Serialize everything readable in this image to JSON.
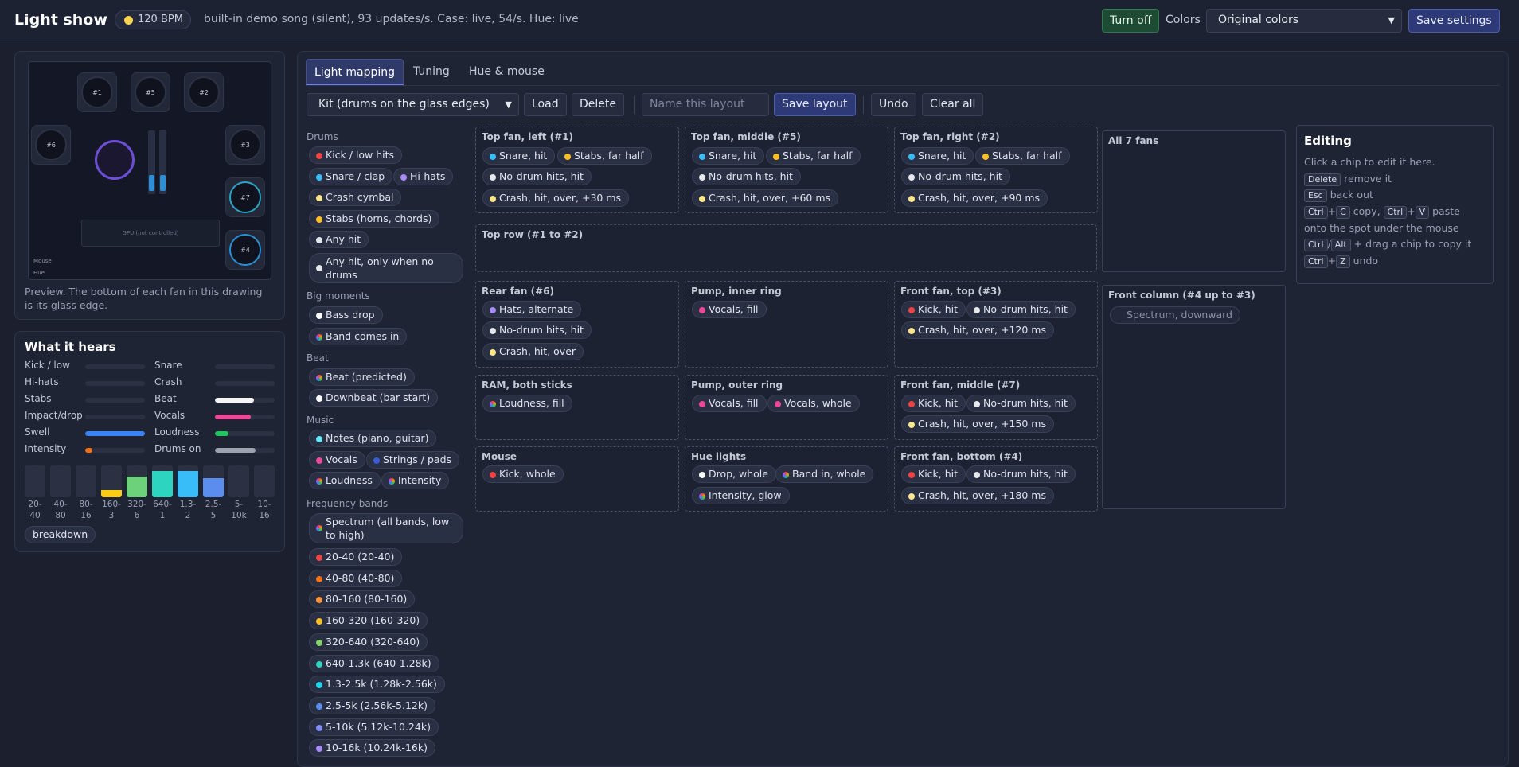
{
  "header": {
    "title": "Light show",
    "bpm": "120 BPM",
    "status": "built-in demo song (silent), 93 updates/s. Case: live, 54/s. Hue: live",
    "turn_off": "Turn off",
    "colors_label": "Colors",
    "colors_value": "Original colors",
    "save_settings": "Save settings"
  },
  "preview": {
    "fan_labels": [
      "#1",
      "#5",
      "#2",
      "#6",
      "#3",
      "#7",
      "#4"
    ],
    "gpu_label": "GPU (not controlled)",
    "mouse_label": "Mouse",
    "hue_label": "Hue",
    "caption": "Preview. The bottom of each fan in this drawing is its glass edge."
  },
  "hears": {
    "title": "What it hears",
    "meters": [
      {
        "name": "Kick / low",
        "level": 0,
        "color": "#3b82f6"
      },
      {
        "name": "Snare",
        "level": 0,
        "color": "#3b82f6"
      },
      {
        "name": "Hi-hats",
        "level": 0,
        "color": "#3b82f6"
      },
      {
        "name": "Crash",
        "level": 0,
        "color": "#3b82f6"
      },
      {
        "name": "Stabs",
        "level": 0,
        "color": "#3b82f6"
      },
      {
        "name": "Beat",
        "level": 0.65,
        "color": "#f5f5f5"
      },
      {
        "name": "Impact/drop",
        "level": 0,
        "color": "#3b82f6"
      },
      {
        "name": "Vocals",
        "level": 0.6,
        "color": "#ec4899"
      },
      {
        "name": "Swell",
        "level": 1.0,
        "color": "#3b82f6"
      },
      {
        "name": "Loudness",
        "level": 0.22,
        "color": "#22c55e"
      },
      {
        "name": "Intensity",
        "level": 0.12,
        "color": "#f97316"
      },
      {
        "name": "Drums on",
        "level": 0.68,
        "color": "#9ca3af"
      }
    ],
    "bands": [
      {
        "label": "20-\n40",
        "level": 0,
        "color": "#facc15"
      },
      {
        "label": "40-\n80",
        "level": 0,
        "color": "#facc15"
      },
      {
        "label": "80-\n16",
        "level": 0,
        "color": "#facc15"
      },
      {
        "label": "160-\n3",
        "level": 0.22,
        "color": "#facc15"
      },
      {
        "label": "320-\n6",
        "level": 0.65,
        "color": "#6dd07a"
      },
      {
        "label": "640-\n1",
        "level": 0.82,
        "color": "#2dd4bf"
      },
      {
        "label": "1.3-\n2",
        "level": 0.82,
        "color": "#38bdf8"
      },
      {
        "label": "2.5-\n5",
        "level": 0.6,
        "color": "#5b8def"
      },
      {
        "label": "5-\n10k",
        "level": 0,
        "color": "#facc15"
      },
      {
        "label": "10-\n16",
        "level": 0,
        "color": "#facc15"
      }
    ],
    "breakdown": "breakdown"
  },
  "tabs": [
    "Light mapping",
    "Tuning",
    "Hue & mouse"
  ],
  "toolbar": {
    "layout_select": "Kit (drums on the glass edges)",
    "load": "Load",
    "delete": "Delete",
    "name_placeholder": "Name this layout",
    "save_layout": "Save layout",
    "undo": "Undo",
    "clear_all": "Clear all"
  },
  "palette": {
    "sections": [
      "Drums",
      "Big moments",
      "Beat",
      "Music",
      "Frequency bands"
    ],
    "drums": [
      {
        "label": "Kick / low hits",
        "color": "#ef4444"
      },
      {
        "label": "Snare / clap",
        "color": "#38bdf8"
      },
      {
        "label": "Hi-hats",
        "color": "#a78bfa"
      },
      {
        "label": "Crash cymbal",
        "color": "#fde68a"
      },
      {
        "label": "Stabs (horns, chords)",
        "color": "#fbbf24"
      },
      {
        "label": "Any hit",
        "color": "#e5e7eb"
      },
      {
        "label": "Any hit, only when no drums",
        "color": "#e5e7eb"
      }
    ],
    "big": [
      {
        "label": "Bass drop",
        "color": "#ffffff"
      },
      {
        "label": "Band comes in",
        "color": "rainbow"
      }
    ],
    "beat": [
      {
        "label": "Beat (predicted)",
        "color": "rainbow"
      },
      {
        "label": "Downbeat (bar start)",
        "color": "#ffffff"
      }
    ],
    "music": [
      {
        "label": "Notes (piano, guitar)",
        "color": "#67e8f9"
      },
      {
        "label": "Vocals",
        "color": "#ec4899"
      },
      {
        "label": "Strings / pads",
        "color": "#3b5bdb"
      },
      {
        "label": "Loudness",
        "color": "rainbow"
      },
      {
        "label": "Intensity",
        "color": "rainbow"
      }
    ],
    "bands": [
      {
        "label": "Spectrum (all bands, low to high)",
        "color": "rainbow"
      },
      {
        "label": "20-40 (20-40)",
        "color": "#ef4444"
      },
      {
        "label": "40-80 (40-80)",
        "color": "#f97316"
      },
      {
        "label": "80-160 (80-160)",
        "color": "#fb923c"
      },
      {
        "label": "160-320 (160-320)",
        "color": "#fbbf24"
      },
      {
        "label": "320-640 (320-640)",
        "color": "#86d46a"
      },
      {
        "label": "640-1.3k (640-1.28k)",
        "color": "#2dd4bf"
      },
      {
        "label": "1.3-2.5k (1.28k-2.56k)",
        "color": "#22d3ee"
      },
      {
        "label": "2.5-5k (2.56k-5.12k)",
        "color": "#5b8def"
      },
      {
        "label": "5-10k (5.12k-10.24k)",
        "color": "#818cf8"
      },
      {
        "label": "10-16k (10.24k-16k)",
        "color": "#a78bfa"
      }
    ]
  },
  "zones": {
    "top_left": {
      "title": "Top fan, left (#1)",
      "chips": [
        {
          "label": "Snare, hit",
          "color": "#38bdf8"
        },
        {
          "label": "Stabs, far half",
          "color": "#fbbf24"
        },
        {
          "label": "No-drum hits, hit",
          "color": "#e5e7eb"
        },
        {
          "label": "Crash, hit, over, +30 ms",
          "color": "#fde68a"
        }
      ]
    },
    "top_mid": {
      "title": "Top fan, middle (#5)",
      "chips": [
        {
          "label": "Snare, hit",
          "color": "#38bdf8"
        },
        {
          "label": "Stabs, far half",
          "color": "#fbbf24"
        },
        {
          "label": "No-drum hits, hit",
          "color": "#e5e7eb"
        },
        {
          "label": "Crash, hit, over, +60 ms",
          "color": "#fde68a"
        }
      ]
    },
    "top_right": {
      "title": "Top fan, right (#2)",
      "chips": [
        {
          "label": "Snare, hit",
          "color": "#38bdf8"
        },
        {
          "label": "Stabs, far half",
          "color": "#fbbf24"
        },
        {
          "label": "No-drum hits, hit",
          "color": "#e5e7eb"
        },
        {
          "label": "Crash, hit, over, +90 ms",
          "color": "#fde68a"
        }
      ]
    },
    "top_row": {
      "title": "Top row (#1 to #2)"
    },
    "rear": {
      "title": "Rear fan (#6)",
      "chips": [
        {
          "label": "Hats, alternate",
          "color": "#a78bfa"
        },
        {
          "label": "No-drum hits, hit",
          "color": "#e5e7eb"
        },
        {
          "label": "Crash, hit, over",
          "color": "#fde68a"
        }
      ]
    },
    "pump_inner": {
      "title": "Pump, inner ring",
      "chips": [
        {
          "label": "Vocals, fill",
          "color": "#ec4899"
        }
      ]
    },
    "front_top": {
      "title": "Front fan, top (#3)",
      "chips": [
        {
          "label": "Kick, hit",
          "color": "#ef4444"
        },
        {
          "label": "No-drum hits, hit",
          "color": "#e5e7eb"
        },
        {
          "label": "Crash, hit, over, +120 ms",
          "color": "#fde68a"
        }
      ]
    },
    "ram": {
      "title": "RAM, both sticks",
      "chips": [
        {
          "label": "Loudness, fill",
          "color": "rainbow"
        }
      ]
    },
    "pump_outer": {
      "title": "Pump, outer ring",
      "chips": [
        {
          "label": "Vocals, fill",
          "color": "#ec4899"
        },
        {
          "label": "Vocals, whole",
          "color": "#ec4899"
        }
      ]
    },
    "front_mid": {
      "title": "Front fan, middle (#7)",
      "chips": [
        {
          "label": "Kick, hit",
          "color": "#ef4444"
        },
        {
          "label": "No-drum hits, hit",
          "color": "#e5e7eb"
        },
        {
          "label": "Crash, hit, over, +150 ms",
          "color": "#fde68a"
        }
      ]
    },
    "mouse": {
      "title": "Mouse",
      "chips": [
        {
          "label": "Kick, whole",
          "color": "#ef4444"
        }
      ]
    },
    "hue": {
      "title": "Hue lights",
      "chips": [
        {
          "label": "Drop, whole",
          "color": "#ffffff"
        },
        {
          "label": "Band in, whole",
          "color": "rainbow"
        },
        {
          "label": "Intensity, glow",
          "color": "rainbow"
        }
      ]
    },
    "front_bottom": {
      "title": "Front fan, bottom (#4)",
      "chips": [
        {
          "label": "Kick, hit",
          "color": "#ef4444"
        },
        {
          "label": "No-drum hits, hit",
          "color": "#e5e7eb"
        },
        {
          "label": "Crash, hit, over, +180 ms",
          "color": "#fde68a"
        }
      ]
    },
    "all_fans": {
      "title": "All 7 fans"
    },
    "front_column": {
      "title": "Front column (#4 up to #3)",
      "chips": [
        {
          "label": "Spectrum, downward",
          "color": "rainbow"
        }
      ]
    }
  },
  "editing": {
    "title": "Editing",
    "hint": "Click a chip to edit it here.",
    "k_delete": "Delete",
    "t_delete": "remove it",
    "k_esc": "Esc",
    "t_esc": "back out",
    "k_ctrl": "Ctrl",
    "k_c": "C",
    "t_copy": "copy,",
    "k_v": "V",
    "t_paste": "paste",
    "t_onto": "onto the spot under the mouse",
    "k_alt": "Alt",
    "t_drag": "+ drag a chip to copy it",
    "k_z": "Z",
    "t_undo": "undo"
  }
}
